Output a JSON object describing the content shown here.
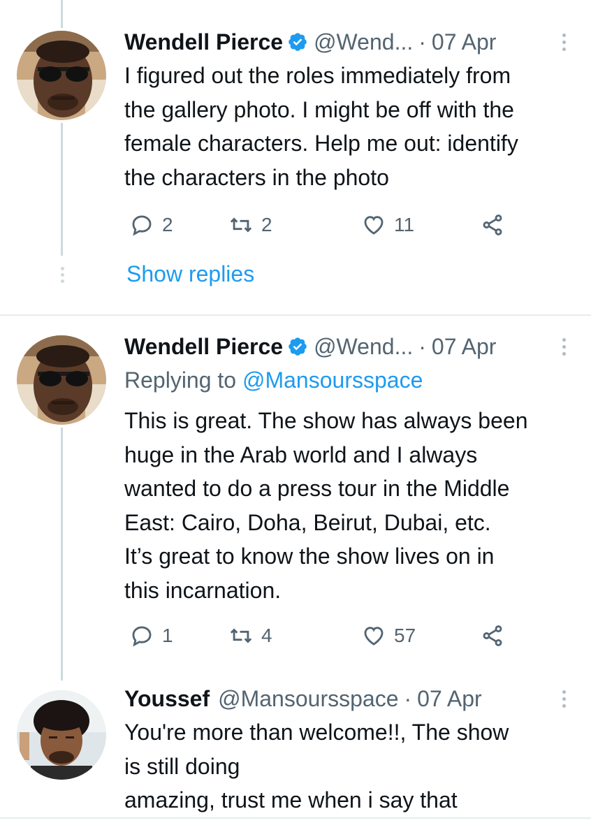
{
  "tweets": [
    {
      "name": "Wendell Pierce",
      "verified": true,
      "handle": "@Wend...",
      "separator": "·",
      "date": "07 Apr",
      "lines": [
        "I figured out the roles immediately from",
        "the gallery photo. I might be off with the",
        "female characters. Help me out: identify",
        "the characters in the photo"
      ],
      "replies": "2",
      "retweets": "2",
      "likes": "11",
      "show_replies": "Show replies"
    },
    {
      "name": "Wendell Pierce",
      "verified": true,
      "handle": "@Wend...",
      "separator": "·",
      "date": "07 Apr",
      "replying_prefix": "Replying to",
      "replying_to": "@Mansoursspace",
      "lines": [
        "This is great. The show has always been",
        "huge in the Arab world and I always",
        "wanted to do a press tour in the Middle",
        "East: Cairo, Doha, Beirut, Dubai, etc.",
        "It’s great to know the show lives on in",
        "this incarnation."
      ],
      "replies": "1",
      "retweets": "4",
      "likes": "57"
    },
    {
      "name": "Youssef",
      "verified": false,
      "handle": "@Mansoursspace",
      "separator": "·",
      "date": "07 Apr",
      "lines": [
        "You're more than welcome!!, The show",
        "is still doing",
        "amazing, trust me when i say that"
      ]
    }
  ],
  "icons": {
    "reply": "reply-icon",
    "retweet": "retweet-icon",
    "like": "heart-icon",
    "share": "share-icon",
    "verified": "verified-badge-icon",
    "more": "more-options-icon"
  },
  "colors": {
    "link": "#1d9bf0",
    "secondary_text": "#536471",
    "thread_line": "#cfd9de",
    "verified": "#1d9bf0"
  }
}
